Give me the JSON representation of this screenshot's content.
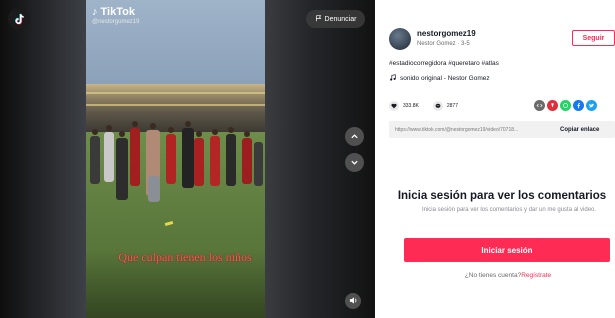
{
  "video": {
    "brand_name": "TikTok",
    "brand_handle": "@nestorgomez19",
    "caption_text": "Que culpan tienen los niños",
    "report_label": "Denunciar"
  },
  "author": {
    "username": "nestorgomez19",
    "subinfo": "Nestor Gomez · 3-5",
    "follow_label": "Seguir"
  },
  "post": {
    "hashtags": "#estadiocorregidora #queretaro #atlas",
    "sound": "sonido original - Nestor Gomez"
  },
  "stats": {
    "likes": "333.8K",
    "comments": "2877"
  },
  "share": {
    "link": "https://www.tiktok.com/@nestorgomez19/video/70718...",
    "copy_label": "Copiar enlace"
  },
  "login": {
    "title": "Inicia sesión para ver los comentarios",
    "subtitle": "Inicia sesión para ver los comentarios y dar un me gusta al video.",
    "button_label": "Iniciar sesión",
    "no_account": "¿No tienes cuenta?",
    "register_label": "Regístrate"
  },
  "icons": {
    "tiktok": "tiktok-logo-icon",
    "flag": "flag-icon",
    "up": "chevron-up-icon",
    "down": "chevron-down-icon",
    "volume": "volume-icon",
    "music": "music-note-icon",
    "heart": "heart-icon",
    "comment": "comment-icon",
    "share": [
      "embed-icon",
      "pinterest-icon",
      "whatsapp-icon",
      "facebook-icon",
      "twitter-icon"
    ]
  },
  "colors": {
    "accent": "#fe2c55",
    "text": "#161823",
    "muted": "#8a8b91"
  }
}
